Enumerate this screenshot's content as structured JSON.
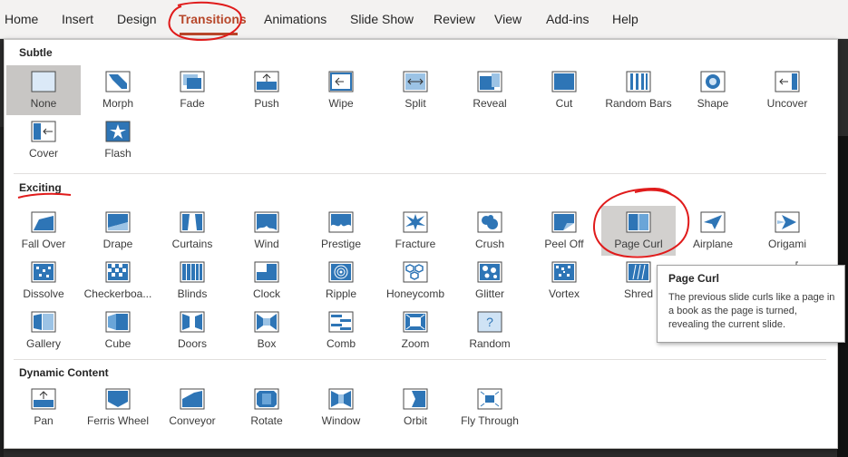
{
  "ribbon": {
    "tabs": [
      "Home",
      "Insert",
      "Design",
      "Transitions",
      "Animations",
      "Slide Show",
      "Review",
      "View",
      "Add-ins",
      "Help"
    ],
    "active_tab": "Transitions"
  },
  "colors": {
    "accent": "#b7472a",
    "icon_blue": "#2e75b6",
    "annotation_red": "#e01b1b"
  },
  "sections": [
    {
      "title": "Subtle",
      "items": [
        {
          "label": "None",
          "icon": "none-icon"
        },
        {
          "label": "Morph",
          "icon": "morph-icon"
        },
        {
          "label": "Fade",
          "icon": "fade-icon"
        },
        {
          "label": "Push",
          "icon": "push-icon"
        },
        {
          "label": "Wipe",
          "icon": "wipe-icon"
        },
        {
          "label": "Split",
          "icon": "split-icon"
        },
        {
          "label": "Reveal",
          "icon": "reveal-icon"
        },
        {
          "label": "Cut",
          "icon": "cut-icon"
        },
        {
          "label": "Random Bars",
          "icon": "random-bars-icon"
        },
        {
          "label": "Shape",
          "icon": "shape-icon"
        },
        {
          "label": "Uncover",
          "icon": "uncover-icon"
        },
        {
          "label": "Cover",
          "icon": "cover-icon"
        },
        {
          "label": "Flash",
          "icon": "flash-icon"
        }
      ]
    },
    {
      "title": "Exciting",
      "items": [
        {
          "label": "Fall Over",
          "icon": "fall-over-icon"
        },
        {
          "label": "Drape",
          "icon": "drape-icon"
        },
        {
          "label": "Curtains",
          "icon": "curtains-icon"
        },
        {
          "label": "Wind",
          "icon": "wind-icon"
        },
        {
          "label": "Prestige",
          "icon": "prestige-icon"
        },
        {
          "label": "Fracture",
          "icon": "fracture-icon"
        },
        {
          "label": "Crush",
          "icon": "crush-icon"
        },
        {
          "label": "Peel Off",
          "icon": "peel-off-icon"
        },
        {
          "label": "Page Curl",
          "icon": "page-curl-icon"
        },
        {
          "label": "Airplane",
          "icon": "airplane-icon"
        },
        {
          "label": "Origami",
          "icon": "origami-icon"
        },
        {
          "label": "Dissolve",
          "icon": "dissolve-icon"
        },
        {
          "label": "Checkerboa...",
          "icon": "checkerboard-icon"
        },
        {
          "label": "Blinds",
          "icon": "blinds-icon"
        },
        {
          "label": "Clock",
          "icon": "clock-icon"
        },
        {
          "label": "Ripple",
          "icon": "ripple-icon"
        },
        {
          "label": "Honeycomb",
          "icon": "honeycomb-icon"
        },
        {
          "label": "Glitter",
          "icon": "glitter-icon"
        },
        {
          "label": "Vortex",
          "icon": "vortex-icon"
        },
        {
          "label": "Shred",
          "icon": "shred-icon"
        },
        {
          "label": "",
          "icon": "partially-hidden-icon"
        },
        {
          "label": "",
          "icon": "partially-hidden-icon"
        },
        {
          "label": "Gallery",
          "icon": "gallery-icon"
        },
        {
          "label": "Cube",
          "icon": "cube-icon"
        },
        {
          "label": "Doors",
          "icon": "doors-icon"
        },
        {
          "label": "Box",
          "icon": "box-icon"
        },
        {
          "label": "Comb",
          "icon": "comb-icon"
        },
        {
          "label": "Zoom",
          "icon": "zoom-icon"
        },
        {
          "label": "Random",
          "icon": "random-icon"
        }
      ]
    },
    {
      "title": "Dynamic Content",
      "items": [
        {
          "label": "Pan",
          "icon": "pan-icon"
        },
        {
          "label": "Ferris Wheel",
          "icon": "ferris-wheel-icon"
        },
        {
          "label": "Conveyor",
          "icon": "conveyor-icon"
        },
        {
          "label": "Rotate",
          "icon": "rotate-icon"
        },
        {
          "label": "Window",
          "icon": "window-icon"
        },
        {
          "label": "Orbit",
          "icon": "orbit-icon"
        },
        {
          "label": "Fly Through",
          "icon": "fly-through-icon"
        }
      ]
    }
  ],
  "selected": "None",
  "hovered": "Page Curl",
  "tooltip": {
    "title": "Page Curl",
    "body": "The previous slide curls like a page in a book as the page is turned, revealing the current slide."
  }
}
